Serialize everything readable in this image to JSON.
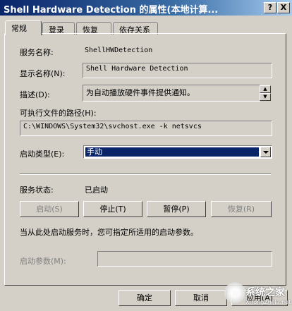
{
  "window": {
    "title": "Shell Hardware Detection 的属性(本地计算...",
    "help_glyph": "?",
    "close_glyph": "X"
  },
  "tabs": [
    {
      "label": "常规",
      "active": true
    },
    {
      "label": "登录",
      "active": false
    },
    {
      "label": "恢复",
      "active": false
    },
    {
      "label": "依存关系",
      "active": false
    }
  ],
  "general": {
    "service_name_label": "服务名称:",
    "service_name_value": "ShellHWDetection",
    "display_name_label": "显示名称(N):",
    "display_name_value": "Shell Hardware Detection",
    "description_label": "描述(D):",
    "description_value": "为自动播放硬件事件提供通知。",
    "exec_path_label": "可执行文件的路径(H):",
    "exec_path_value": "C:\\WINDOWS\\System32\\svchost.exe -k netsvcs",
    "startup_type_label": "启动类型(E):",
    "startup_type_value": "手动",
    "service_status_label": "服务状态:",
    "service_status_value": "已启动",
    "start_button": "启动(S)",
    "stop_button": "停止(T)",
    "pause_button": "暂停(P)",
    "resume_button": "恢复(R)",
    "hint_text": "当从此处启动服务时，您可指定所适用的启动参数。",
    "start_params_label": "启动参数(M):",
    "start_params_value": ""
  },
  "footer": {
    "ok_button": "确定",
    "cancel_button": "取消",
    "apply_button": "应用(A)"
  },
  "watermark": {
    "brand": "系统之家",
    "url": "XiTongZhiJia.net"
  }
}
